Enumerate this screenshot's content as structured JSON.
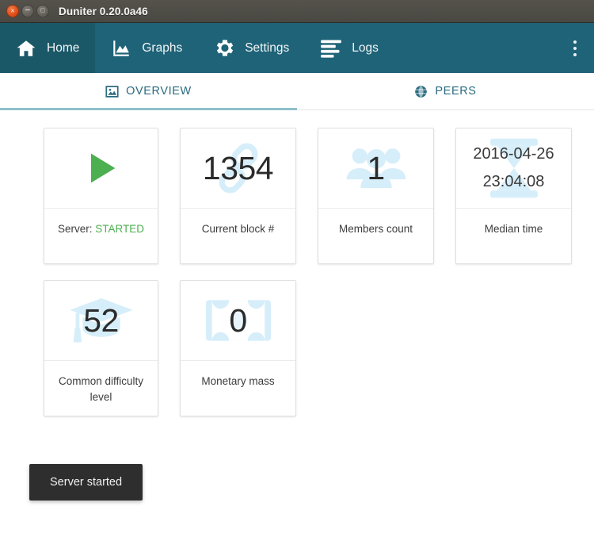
{
  "window": {
    "title": "Duniter 0.20.0a46",
    "controls": [
      {
        "name": "close",
        "glyph": "×"
      },
      {
        "name": "minimize",
        "glyph": "−"
      },
      {
        "name": "maximize",
        "glyph": "□"
      }
    ]
  },
  "nav": {
    "items": [
      {
        "label": "Home",
        "icon": "home-icon",
        "active": true
      },
      {
        "label": "Graphs",
        "icon": "chart-icon",
        "active": false
      },
      {
        "label": "Settings",
        "icon": "gear-icon",
        "active": false
      },
      {
        "label": "Logs",
        "icon": "list-icon",
        "active": false
      }
    ],
    "overflow_label": "More options",
    "background_color": "#1f6378",
    "active_color": "#1a5868"
  },
  "tabs": [
    {
      "label": "OVERVIEW",
      "icon": "image-icon",
      "active": true
    },
    {
      "label": "PEERS",
      "icon": "globe-icon",
      "active": false
    }
  ],
  "tab_accent_color": "#8fc0cb",
  "cards": [
    {
      "value": "",
      "value_lines": [],
      "caption_prefix": "Server:",
      "caption_status": "STARTED",
      "caption": "",
      "icon": "play-icon",
      "status_color": "#4caf50"
    },
    {
      "value": "1354",
      "caption": "Current block #",
      "icon": "chain-link-icon"
    },
    {
      "value": "1",
      "caption": "Members count",
      "icon": "users-icon"
    },
    {
      "value_lines": [
        "2016-04-26",
        "23:04:08"
      ],
      "caption": "Median time",
      "icon": "hourglass-icon"
    },
    {
      "value": "52",
      "caption": "Common difficulty\nlevel",
      "icon": "graduation-cap-icon"
    },
    {
      "value": "0",
      "caption": "Monetary mass",
      "icon": "banknote-icon"
    }
  ],
  "toast": {
    "message": "Server started"
  }
}
